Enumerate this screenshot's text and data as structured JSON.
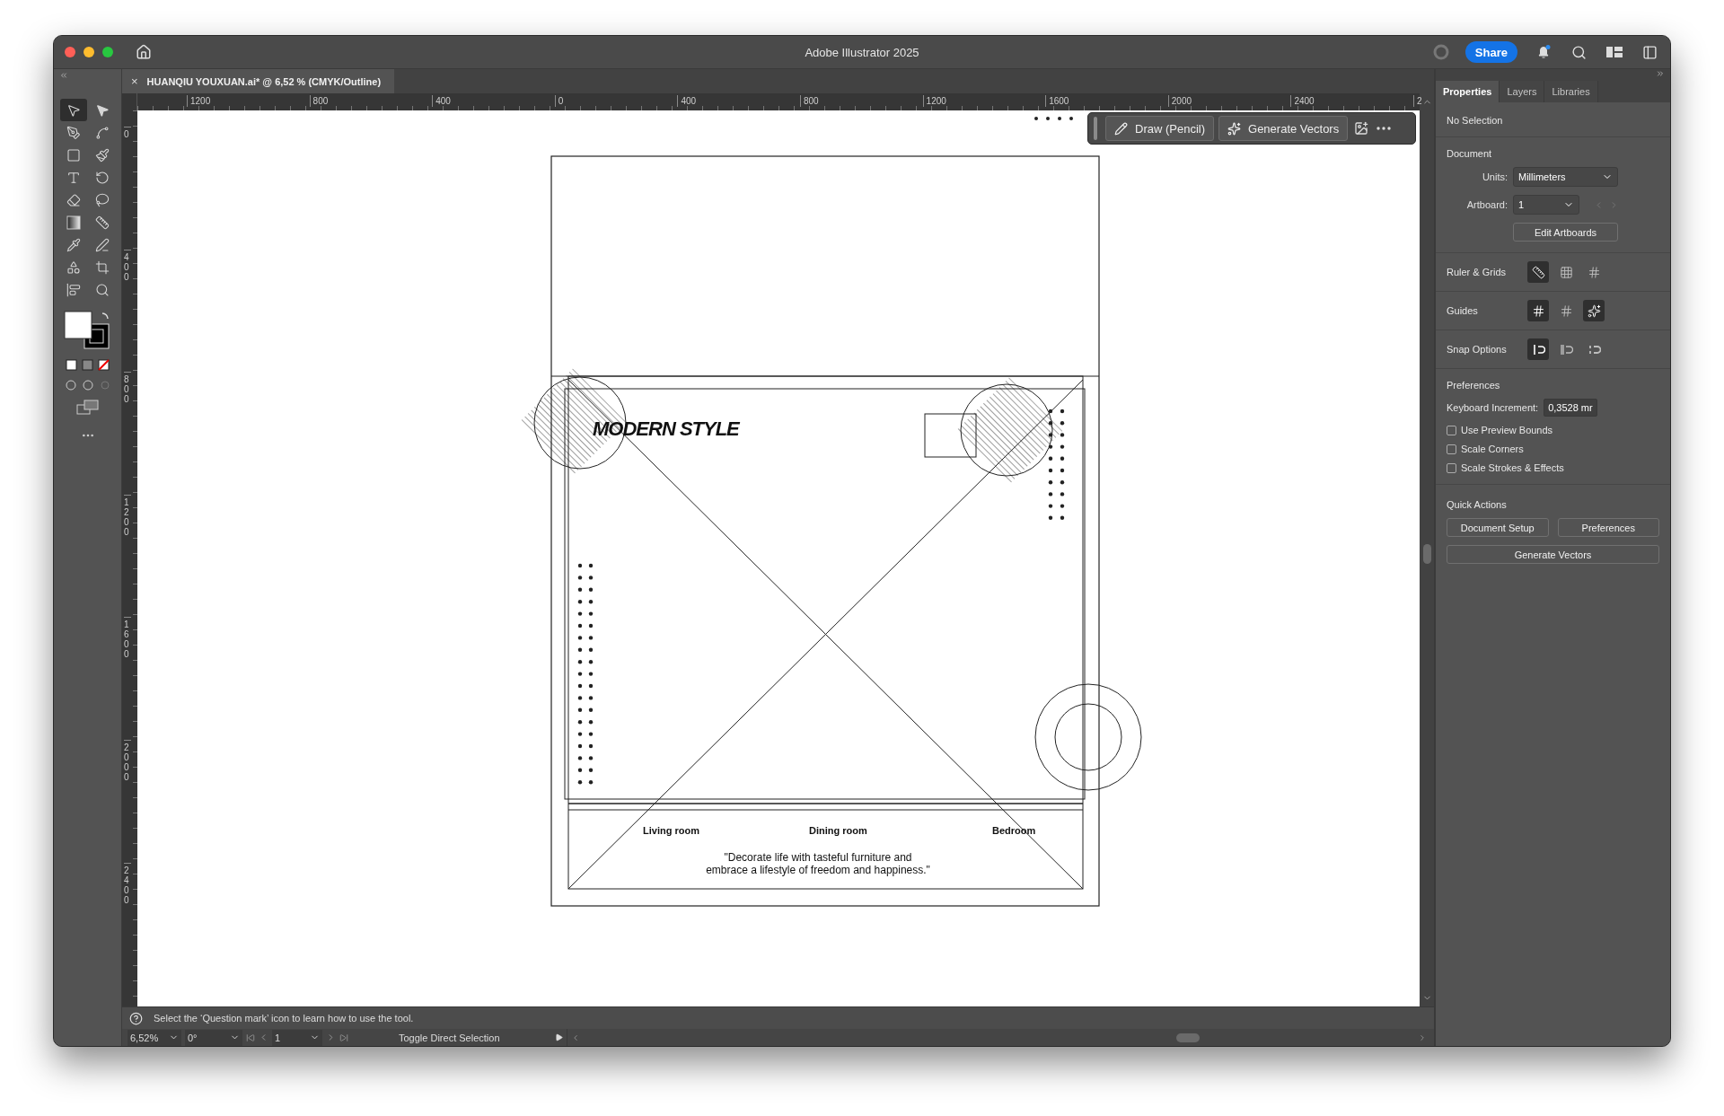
{
  "window": {
    "title": "Adobe Illustrator 2025",
    "share": "Share"
  },
  "document_tab": {
    "close": "×",
    "title": "HUANQIU YOUXUAN.ai* @ 6,52 % (CMYK/Outline)"
  },
  "tools": [
    {
      "kind": "selection",
      "selected": true
    },
    {
      "kind": "direct",
      "selected": false
    },
    {
      "kind": "pen",
      "selected": false
    },
    {
      "kind": "curvature",
      "selected": false
    },
    {
      "kind": "rectangle",
      "selected": false
    },
    {
      "kind": "brush",
      "selected": false
    },
    {
      "kind": "type",
      "selected": false
    },
    {
      "kind": "rotate",
      "selected": false
    },
    {
      "kind": "eraser",
      "selected": false
    },
    {
      "kind": "lasso",
      "selected": false
    },
    {
      "kind": "gradient",
      "selected": false
    },
    {
      "kind": "width",
      "selected": false
    },
    {
      "kind": "eyedropper",
      "selected": false
    },
    {
      "kind": "puppet",
      "selected": false
    },
    {
      "kind": "shapes",
      "selected": false
    },
    {
      "kind": "artboard",
      "selected": false
    },
    {
      "kind": "align",
      "selected": false
    },
    {
      "kind": "zoom",
      "selected": false
    }
  ],
  "rulers": {
    "horizontal": [
      "1200",
      "800",
      "400",
      "0",
      "400",
      "800",
      "1200",
      "1600",
      "2000",
      "2400",
      "2"
    ],
    "vertical": [
      "0",
      "400",
      "800",
      "1200",
      "1600",
      "2000",
      "2400"
    ]
  },
  "contextual_bar": {
    "buttons": [
      "Draw (Pencil)",
      "Generate Vectors"
    ]
  },
  "artboard": {
    "title": "MODERN STYLE",
    "rooms": [
      "Living room",
      "Dining room",
      "Bedroom"
    ],
    "quote_lines": [
      "\"Decorate life with tasteful furniture and",
      "embrace a lifestyle of freedom and happiness.\""
    ]
  },
  "panel": {
    "tabs": [
      {
        "label": "Properties",
        "selected": true
      },
      {
        "label": "Layers",
        "selected": false
      },
      {
        "label": "Libraries",
        "selected": false
      }
    ],
    "selection": "No Selection",
    "document": {
      "heading": "Document",
      "units_label": "Units:",
      "units": "Millimeters",
      "artboard_label": "Artboard:",
      "artboard": "1",
      "edit_button": "Edit Artboards"
    },
    "toggle_rows": [
      {
        "label": "Ruler & Grids",
        "toggles": [
          {
            "on": true
          },
          {
            "on": false
          },
          {
            "on": false
          }
        ]
      },
      {
        "label": "Guides",
        "toggles": [
          {
            "on": true
          },
          {
            "on": false
          },
          {
            "on": true
          }
        ]
      },
      {
        "label": "Snap Options",
        "toggles": [
          {
            "on": true
          },
          {
            "on": false
          },
          {
            "on": false
          }
        ]
      }
    ],
    "preferences": {
      "heading": "Preferences",
      "increment_label": "Keyboard Increment:",
      "increment": "0,3528 mr",
      "checkboxes": [
        {
          "label": "Use Preview Bounds",
          "checked": false
        },
        {
          "label": "Scale Corners",
          "checked": false
        },
        {
          "label": "Scale Strokes & Effects",
          "checked": false
        }
      ]
    },
    "quick_actions": {
      "heading": "Quick Actions",
      "buttons": [
        "Document Setup",
        "Preferences",
        "Generate Vectors"
      ]
    }
  },
  "status": {
    "hint": "Select the ‘Question mark’ icon to learn how to use the tool.",
    "zoom": "6,52%",
    "rotation": "0°",
    "artboard": "1",
    "tool": "Toggle Direct Selection"
  }
}
